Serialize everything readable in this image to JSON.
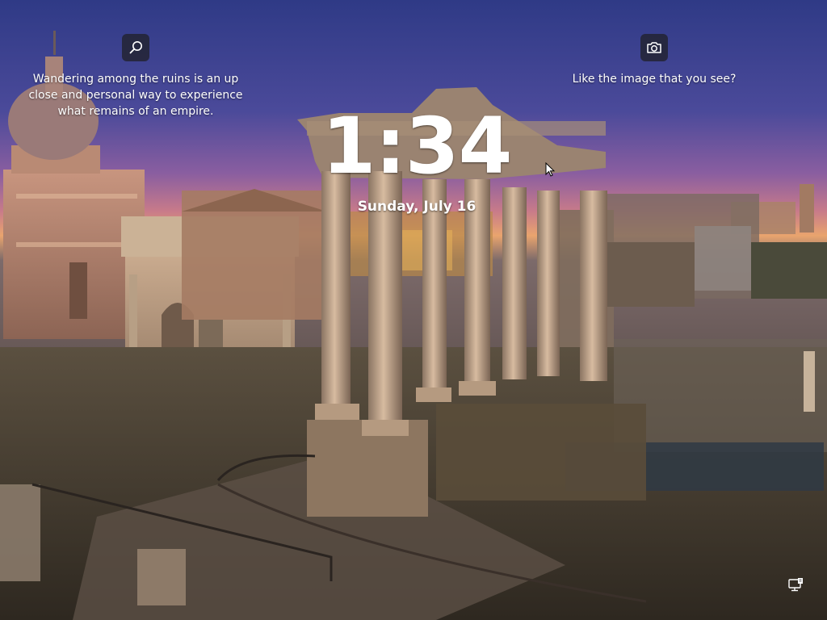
{
  "lockscreen": {
    "time": "1:34",
    "date": "Sunday, July 16"
  },
  "spotlight": {
    "info_icon": "search-icon",
    "info_text_line1": "Wandering among the ruins is an up",
    "info_text_line2": "close and personal way to experience",
    "info_text_line3": "what remains of an empire.",
    "like_icon": "camera-icon",
    "like_text": "Like the image that you see?"
  },
  "status": {
    "network_icon": "network-icon"
  },
  "colors": {
    "sky_top": "#3a3f8a",
    "sunset": "#d98a6e",
    "ruins": "#5a4a3e",
    "tile_bg": "#1e1e22",
    "text": "#ffffff"
  }
}
